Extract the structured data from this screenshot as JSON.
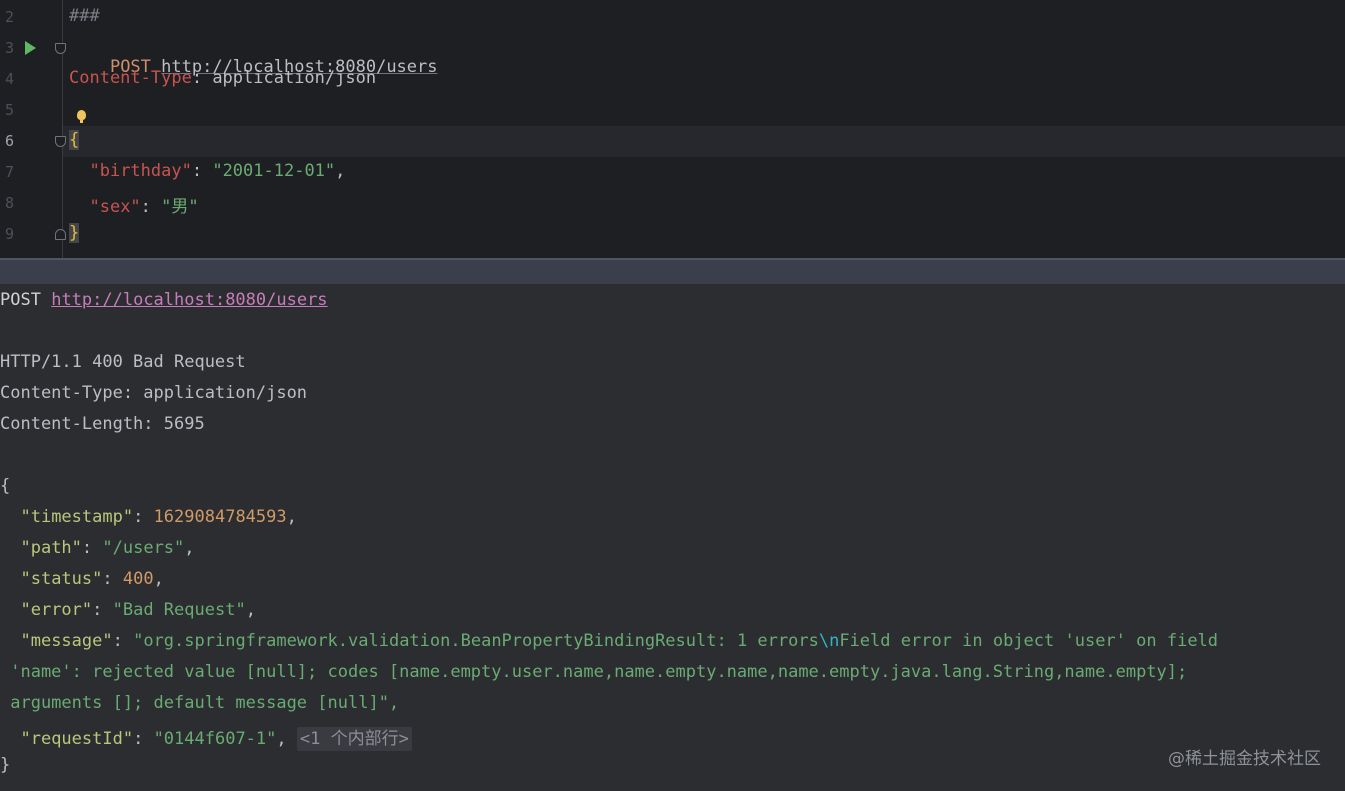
{
  "editor": {
    "line_numbers": [
      "2",
      "3",
      "4",
      "5",
      "6",
      "7",
      "8",
      "9"
    ],
    "comment": "###",
    "method": "POST",
    "url": "http://localhost:8080/users",
    "header_key": "Content-Type",
    "header_sep": ": ",
    "header_value": "application/json",
    "open_brace": "{",
    "close_brace": "}",
    "body": [
      {
        "key": "\"birthday\"",
        "value": "\"2001-12-01\"",
        "trail": ","
      },
      {
        "key": "\"sex\"",
        "value": "\"男\"",
        "trail": ""
      }
    ]
  },
  "response": {
    "method": "POST",
    "url": "http://localhost:8080/users",
    "status_line": "HTTP/1.1 400 Bad Request",
    "headers": [
      "Content-Type: application/json",
      "Content-Length: 5695"
    ],
    "open_brace": "{",
    "close_brace": "}",
    "timestamp_key": "\"timestamp\"",
    "timestamp_value": "1629084784593",
    "path_key": "\"path\"",
    "path_value": "\"/users\"",
    "status_key": "\"status\"",
    "status_value": "400",
    "error_key": "\"error\"",
    "error_value": "\"Bad Request\"",
    "message_key": "\"message\"",
    "message_part1": "\"org.springframework.validation.BeanPropertyBindingResult: 1 errors",
    "message_escape": "\\n",
    "message_part2": "Field error in object 'user' on field",
    "message_line2": " 'name': rejected value [null]; codes [name.empty.user.name,name.empty.name,name.empty.java.lang.String,name.empty];",
    "message_line3": " arguments []; default message [null]\",",
    "requestid_key": "\"requestId\"",
    "requestid_value": "\"0144f607-1\"",
    "fold_hint": "<1 个内部行>"
  },
  "watermark": "@稀土掘金技术社区",
  "icons": {
    "run": "run-icon",
    "fold": "fold-icon",
    "intention": "lightbulb-icon"
  }
}
